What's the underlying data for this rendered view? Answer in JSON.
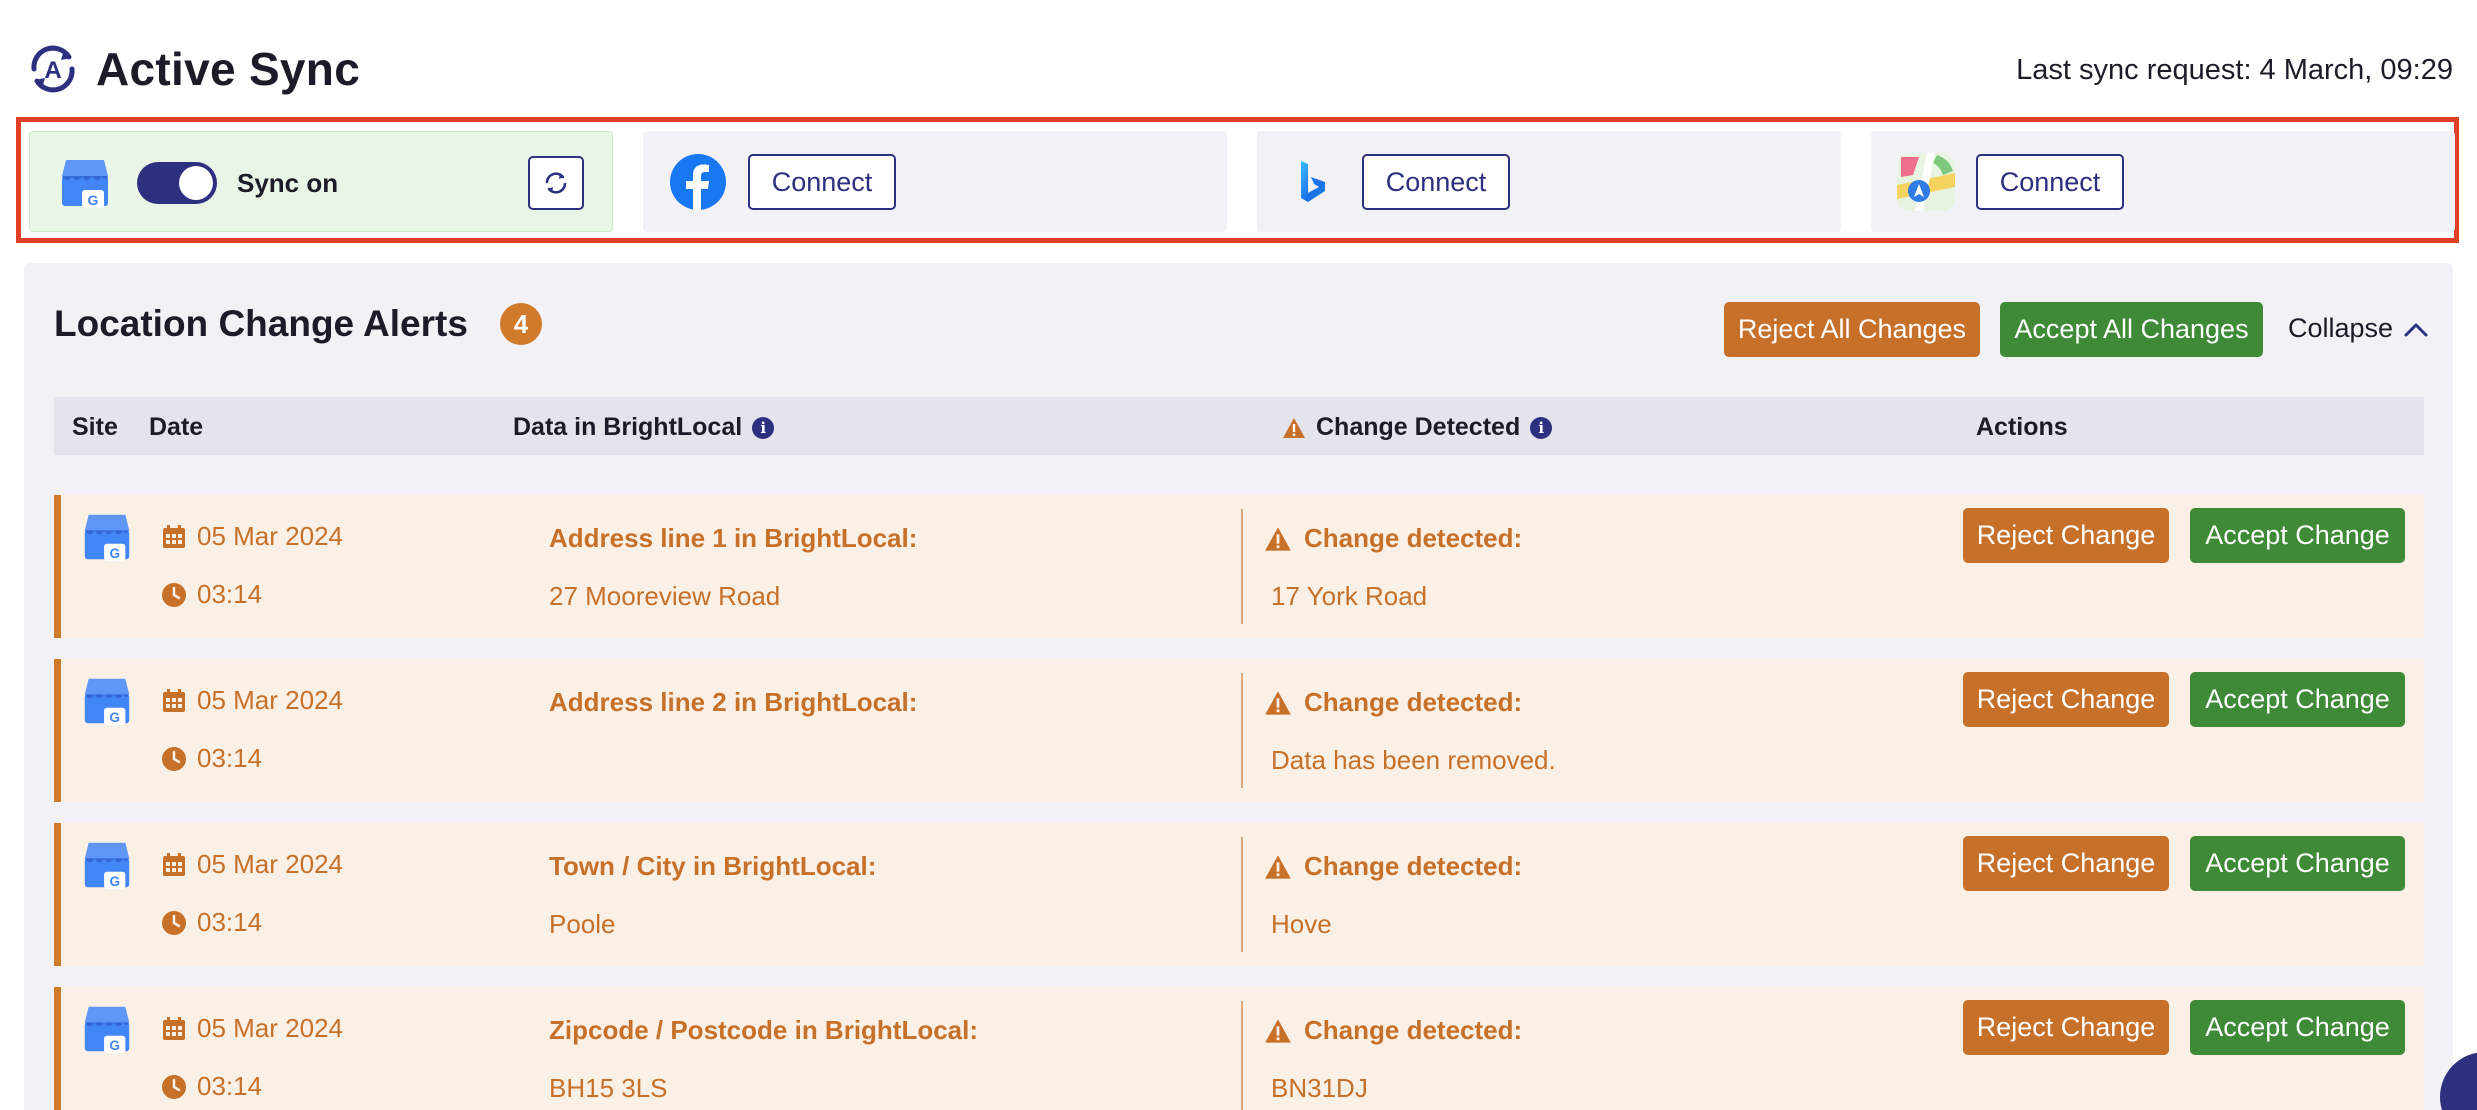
{
  "header": {
    "title": "Active Sync",
    "last_sync": "Last sync request: 4 March, 09:29",
    "brand_icon": "active-sync-logo"
  },
  "platforms": [
    {
      "name": "Google Business Profile",
      "icon": "google-business-icon",
      "sync_label": "Sync on",
      "state": "on"
    },
    {
      "name": "Facebook",
      "icon": "facebook-icon",
      "connect_label": "Connect"
    },
    {
      "name": "Bing",
      "icon": "bing-icon",
      "connect_label": "Connect"
    },
    {
      "name": "Apple Maps",
      "icon": "apple-maps-icon",
      "connect_label": "Connect"
    }
  ],
  "alerts": {
    "title": "Location Change Alerts",
    "count": "4",
    "reject_all_label": "Reject All Changes",
    "accept_all_label": "Accept All Changes",
    "collapse_label": "Collapse",
    "columns": {
      "site": "Site",
      "date": "Date",
      "data": "Data in BrightLocal",
      "change": "Change Detected",
      "actions": "Actions"
    },
    "rows": [
      {
        "date": "05 Mar 2024",
        "time": "03:14",
        "field": "Address line 1 in BrightLocal:",
        "value": "27 Mooreview Road",
        "change_label": "Change detected:",
        "change_value": "17 York Road",
        "reject": "Reject Change",
        "accept": "Accept Change"
      },
      {
        "date": "05 Mar 2024",
        "time": "03:14",
        "field": "Address line 2 in BrightLocal:",
        "value": "",
        "change_label": "Change detected:",
        "change_value": "Data has been removed.",
        "reject": "Reject Change",
        "accept": "Accept Change"
      },
      {
        "date": "05 Mar 2024",
        "time": "03:14",
        "field": "Town / City in BrightLocal:",
        "value": "Poole",
        "change_label": "Change detected:",
        "change_value": "Hove",
        "reject": "Reject Change",
        "accept": "Accept Change"
      },
      {
        "date": "05 Mar 2024",
        "time": "03:14",
        "field": "Zipcode / Postcode in BrightLocal:",
        "value": "BH15 3LS",
        "change_label": "Change detected:",
        "change_value": "BN31DJ",
        "reject": "Reject Change",
        "accept": "Accept Change"
      }
    ]
  },
  "colors": {
    "brand": "#2d2f7f",
    "alert_orange": "#c7702a",
    "accept_green": "#3f8a36",
    "highlight_red": "#e23f26"
  }
}
